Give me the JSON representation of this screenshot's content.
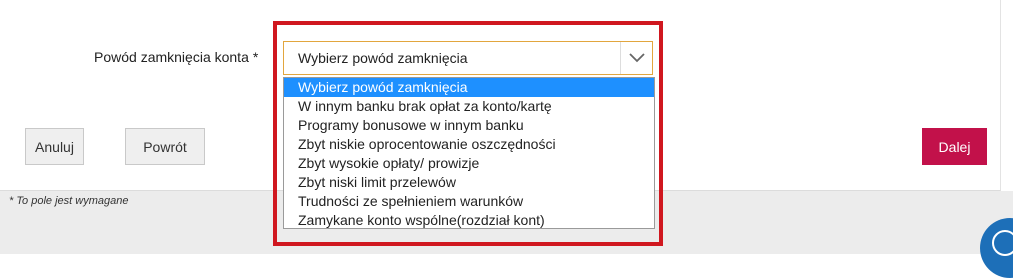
{
  "form": {
    "field_label": "Powód zamknięcia konta",
    "required_mark": "*",
    "select": {
      "value": "Wybierz powód zamknięcia",
      "options": [
        "Wybierz powód zamknięcia",
        "W innym banku brak opłat za konto/kartę",
        "Programy bonusowe w innym banku",
        "Zbyt niskie oprocentowanie oszczędności",
        "Zbyt wysokie opłaty/ prowizje",
        "Zbyt niski limit przelewów",
        "Trudności ze spełnieniem warunków",
        "Zamykane konto wspólne(rozdział kont)"
      ],
      "highlighted_index": 0
    }
  },
  "buttons": {
    "cancel": "Anuluj",
    "back": "Powrót",
    "next": "Dalej"
  },
  "footnote": "* To pole jest wymagane",
  "colors": {
    "next_button": "#c2114a",
    "highlight_frame": "#d0171f",
    "selected_option": "#1e90ff",
    "select_border": "#e2a63e"
  },
  "icons": {
    "select_arrow": "chevron-down-icon",
    "help": "help-icon"
  }
}
